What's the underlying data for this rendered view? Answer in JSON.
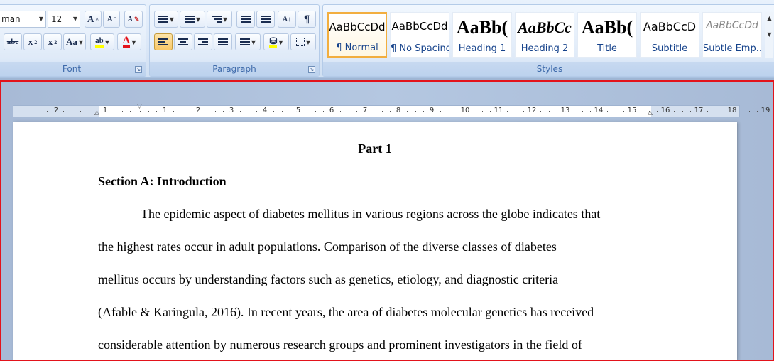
{
  "ribbon": {
    "font_group": {
      "label": "Font",
      "font_name": "man",
      "font_size": "12",
      "buttons": {
        "grow": "A",
        "shrink": "A",
        "clear": "A",
        "strike": "abc",
        "subscript": "x",
        "superscript": "x",
        "change_case": "Aa",
        "highlight": "ab",
        "font_color": "A"
      }
    },
    "paragraph_group": {
      "label": "Paragraph",
      "show_marks": "¶",
      "sort": "A↓"
    },
    "styles_group": {
      "label": "Styles",
      "items": [
        {
          "preview": "AaBbCcDd",
          "name": "¶ Normal"
        },
        {
          "preview": "AaBbCcDd",
          "name": "¶ No Spacing"
        },
        {
          "preview": "AaBb(",
          "name": "Heading 1"
        },
        {
          "preview": "AaBbCc",
          "name": "Heading 2"
        },
        {
          "preview": "AaBb(",
          "name": "Title"
        },
        {
          "preview": "AaBbCcD",
          "name": "Subtitle"
        },
        {
          "preview": "AaBbCcDd",
          "name": "Subtle Emp..."
        }
      ]
    }
  },
  "ruler": {
    "left_labels": [
      "2",
      "1"
    ],
    "labels": [
      "1",
      "2",
      "3",
      "4",
      "5",
      "6",
      "7",
      "8",
      "9",
      "10",
      "11",
      "12",
      "13",
      "14",
      "15",
      "16",
      "17",
      "18",
      "19"
    ]
  },
  "document": {
    "title": "Part 1",
    "section_heading": "Section A: Introduction",
    "paragraph_lines": [
      "The epidemic aspect of diabetes mellitus in various regions across the globe indicates that",
      "the highest rates occur in adult populations. Comparison of the diverse classes of diabetes",
      "mellitus occurs by understanding factors such as genetics, etiology, and diagnostic criteria",
      "(Afable & Karingula, 2016). In recent years, the area of diabetes molecular genetics has received",
      "considerable attention by numerous research groups and prominent investigators in the field of"
    ]
  },
  "colors": {
    "highlight": "#ffff00",
    "font_color": "#e3131b",
    "frame": "#e3131b"
  }
}
